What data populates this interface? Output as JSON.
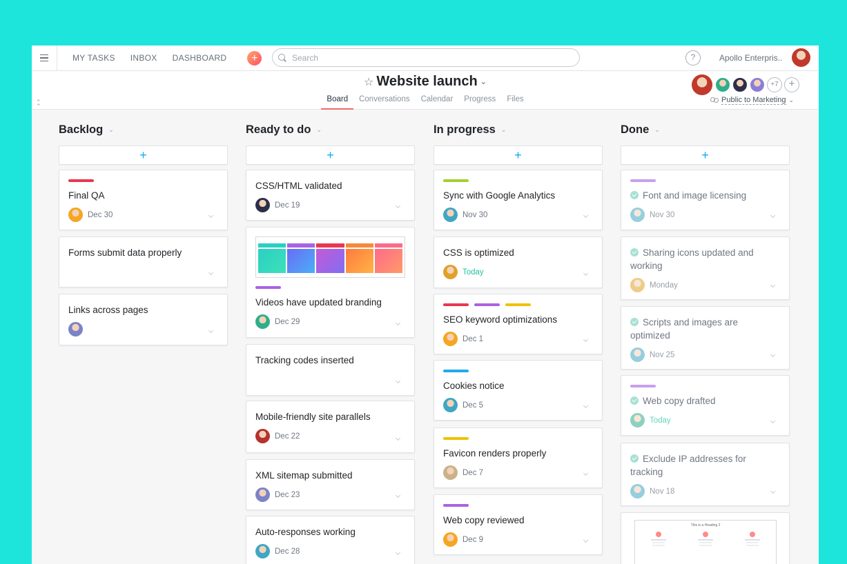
{
  "nav": {
    "links": [
      "MY TASKS",
      "INBOX",
      "DASHBOARD"
    ],
    "add_symbol": "+",
    "search_placeholder": "Search",
    "help_symbol": "?",
    "org": "Apollo Enterpris..",
    "me_color": "#c0392b"
  },
  "project": {
    "title": "Website launch",
    "star": "☆",
    "caret": "⌄",
    "tabs": [
      "Board",
      "Conversations",
      "Calendar",
      "Progress",
      "Files"
    ],
    "active_tab": "Board",
    "more_members": "+7",
    "add_member": "+",
    "privacy": "Public to Marketing",
    "member_colors": [
      "#c0392b",
      "#2fae8a",
      "#2b2f4a",
      "#8a7fd8"
    ]
  },
  "colors": {
    "red": "#e8384f",
    "purple": "#aa62e3",
    "yellow": "#eec300",
    "green": "#a4cf30",
    "blue": "#20aaea",
    "lavender": "#c7a0ec",
    "accent": "#14aaf5",
    "today": "#25c1a1"
  },
  "columns": [
    {
      "name": "Backlog",
      "add": "+",
      "cards": [
        {
          "title": "Final QA",
          "date": "Dec 30",
          "tags": [
            "#e8384f"
          ],
          "avatar": "#f5a623"
        },
        {
          "title": "Forms submit data properly",
          "date": "",
          "tags": [],
          "avatar": ""
        },
        {
          "title": "Links across pages",
          "date": "",
          "tags": [],
          "avatar": "#7b83c9"
        }
      ]
    },
    {
      "name": "Ready to do",
      "add": "+",
      "cards": [
        {
          "title": "CSS/HTML validated",
          "date": "Dec 19",
          "tags": [],
          "avatar": "#2b2f4a"
        },
        {
          "title": "Videos have updated branding",
          "date": "Dec 29",
          "tags": [
            "#aa62e3"
          ],
          "avatar": "#2fae8a",
          "thumbnail": true
        },
        {
          "title": "Tracking codes inserted",
          "date": "",
          "tags": [],
          "avatar": ""
        },
        {
          "title": "Mobile-friendly site parallels",
          "date": "Dec 22",
          "tags": [],
          "avatar": "#b5322f"
        },
        {
          "title": "XML sitemap submitted",
          "date": "Dec 23",
          "tags": [],
          "avatar": "#7b83c9"
        },
        {
          "title": "Auto-responses working",
          "date": "Dec 28",
          "tags": [],
          "avatar": "#3fa7c4"
        }
      ]
    },
    {
      "name": "In progress",
      "add": "+",
      "cards": [
        {
          "title": "Sync with Google Analytics",
          "date": "Nov 30",
          "tags": [
            "#a4cf30"
          ],
          "avatar": "#3fa7c4"
        },
        {
          "title": "CSS is optimized",
          "date": "Today",
          "today": true,
          "tags": [],
          "avatar": "#e0a12a"
        },
        {
          "title": "SEO keyword optimizations",
          "date": "Dec 1",
          "tags": [
            "#e8384f",
            "#aa62e3",
            "#eec300"
          ],
          "avatar": "#f5a623"
        },
        {
          "title": "Cookies notice",
          "date": "Dec 5",
          "tags": [
            "#20aaea"
          ],
          "avatar": "#3fa7c4"
        },
        {
          "title": "Favicon renders properly",
          "date": "Dec 7",
          "tags": [
            "#eec300"
          ],
          "avatar": "#c9b28a"
        },
        {
          "title": "Web copy reviewed",
          "date": "Dec 9",
          "tags": [
            "#aa62e3"
          ],
          "avatar": "#f5a623"
        }
      ]
    },
    {
      "name": "Done",
      "add": "+",
      "cards": [
        {
          "title": "Font and image licensing",
          "date": "Nov 30",
          "tags": [
            "#c7a0ec"
          ],
          "avatar": "#3fa7c4"
        },
        {
          "title": "Sharing icons updated and working",
          "date": "Monday",
          "tags": [],
          "avatar": "#e0a12a"
        },
        {
          "title": "Scripts and images are optimized",
          "date": "Nov 25",
          "tags": [],
          "avatar": "#3fa7c4"
        },
        {
          "title": "Web copy drafted",
          "date": "Today",
          "today": true,
          "tags": [
            "#c7a0ec"
          ],
          "avatar": "#2fae8a"
        },
        {
          "title": "Exclude IP addresses for tracking",
          "date": "Nov 18",
          "tags": [],
          "avatar": "#3fa7c4"
        }
      ],
      "diagram_heading": "This is a Heading 2"
    }
  ]
}
